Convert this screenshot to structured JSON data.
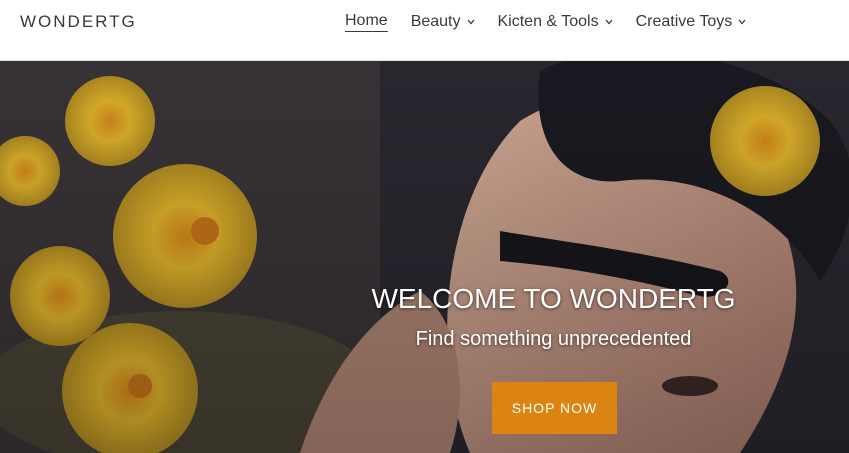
{
  "header": {
    "logo": "WONDERTG",
    "nav": [
      {
        "label": "Home",
        "active": true,
        "dropdown": false
      },
      {
        "label": "Beauty",
        "active": false,
        "dropdown": true
      },
      {
        "label": "Kicten & Tools",
        "active": false,
        "dropdown": true
      },
      {
        "label": "Creative Toys",
        "active": false,
        "dropdown": true
      }
    ]
  },
  "hero": {
    "title": "WELCOME TO WONDERTG",
    "subtitle": "Find something unprecedented",
    "button_label": "SHOP NOW"
  },
  "colors": {
    "accent": "#dc8412",
    "text": "#3a3a3a"
  }
}
